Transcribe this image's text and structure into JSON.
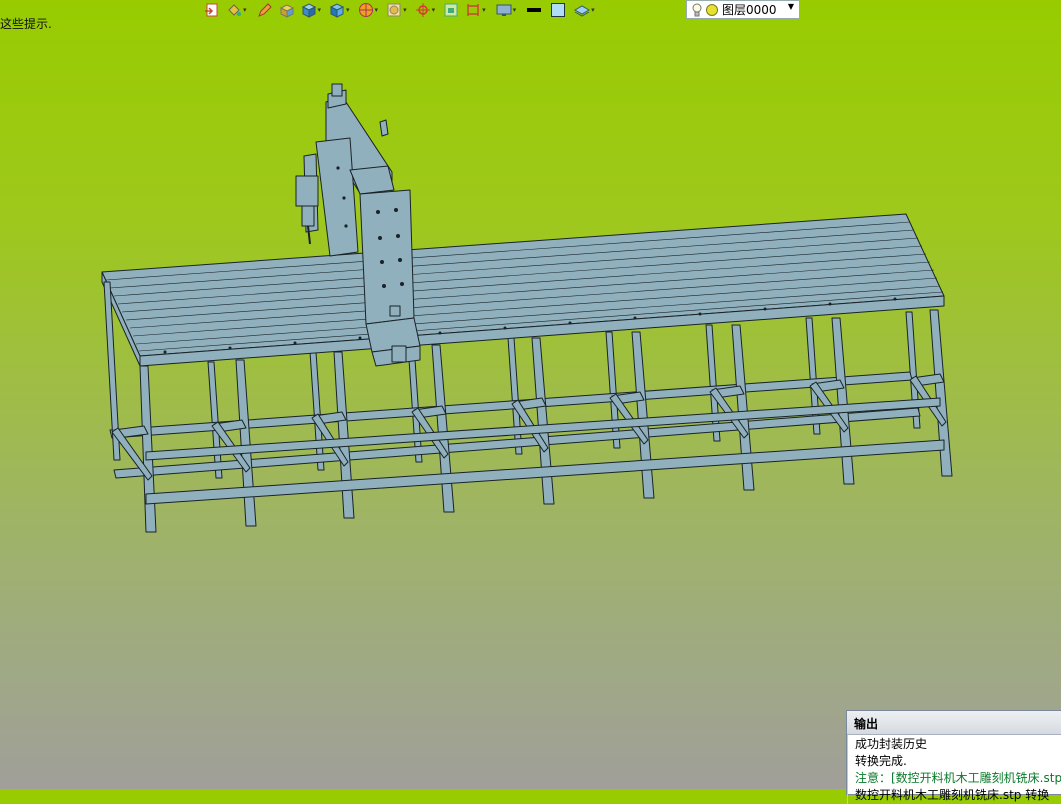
{
  "hint_text": "这些提示.",
  "toolbar": {
    "tools": [
      {
        "icon": "import-icon"
      },
      {
        "icon": "color-bucket-icon"
      },
      {
        "icon": "pencil-icon"
      },
      {
        "icon": "box-shade-icon"
      },
      {
        "icon": "cube-icon"
      },
      {
        "icon": "cube-view-icon"
      },
      {
        "icon": "orientation-icon"
      },
      {
        "icon": "render-mode-icon"
      },
      {
        "icon": "target-icon"
      },
      {
        "icon": "fit-view-icon"
      },
      {
        "icon": "section-icon"
      },
      {
        "icon": "display-icon"
      },
      {
        "icon": "line-style-icon"
      },
      {
        "icon": "color-swatch-icon"
      },
      {
        "icon": "layers-icon"
      }
    ],
    "layer": {
      "label": "图层0000"
    }
  },
  "output_panel": {
    "title": "输出",
    "lines": [
      {
        "text": "成功封装历史",
        "kind": "normal"
      },
      {
        "text": "转换完成.",
        "kind": "normal"
      },
      {
        "text": "注意：[数控开料机木工雕刻机铣床.stp]",
        "kind": "note"
      },
      {
        "text": "数控开料机木工雕刻机铣床.stp 转换",
        "kind": "normal"
      }
    ]
  },
  "colors": {
    "model_fill": "#8fb0bc",
    "model_stroke": "#1a2228",
    "background_top": "#98cc00",
    "background_bottom": "#a09f9a",
    "note_text": "#0a7a2a"
  }
}
